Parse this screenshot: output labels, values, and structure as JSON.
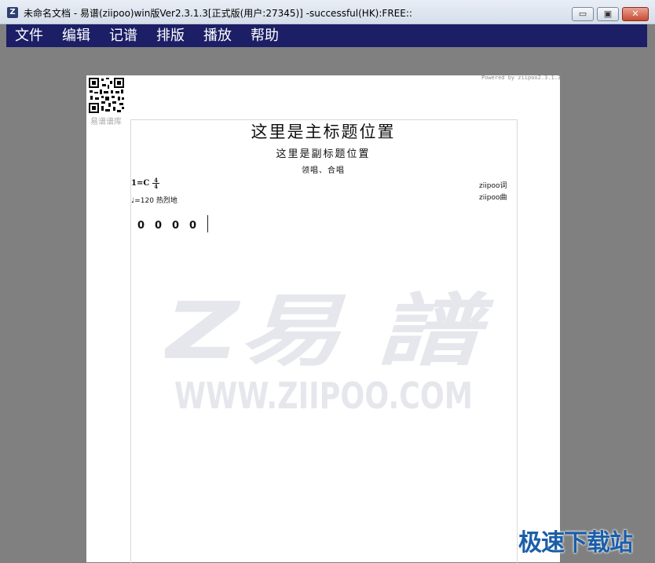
{
  "window": {
    "title": "未命名文档 - 易谱(ziipoo)win版Ver2.3.1.3[正式版(用户:27345)]  -successful(HK):FREE::",
    "icon": "ziipoo-app-icon",
    "controls": {
      "minimize": "▭",
      "maximize": "▣",
      "close": "✕"
    }
  },
  "menu": {
    "items": [
      {
        "label": "文件"
      },
      {
        "label": "编辑"
      },
      {
        "label": "记谱"
      },
      {
        "label": "排版"
      },
      {
        "label": "播放"
      },
      {
        "label": "帮助"
      }
    ]
  },
  "score": {
    "powered_by": "Powered by ziipoo2.3.1.3",
    "qr_label": "易谱谱库",
    "main_title": "这里是主标题位置",
    "sub_title": "这里是副标题位置",
    "singer": "领唱、合唱",
    "key": "1=C",
    "time_sig_top": "4",
    "time_sig_bottom": "4",
    "tempo": "=120 热烈地",
    "lyricist": "ziipoo词",
    "composer": "ziipoo曲",
    "notes": [
      "0",
      "0",
      "0",
      "0"
    ],
    "watermark_line1": "Z易 譜",
    "watermark_line2": "WWW.ZIIPOO.COM"
  },
  "corner_watermark": "极速下载站",
  "colors": {
    "menubar": "#1c1f66",
    "canvas": "#808080",
    "paper": "#ffffff",
    "watermark": "#e6e7ec",
    "corner_brand": "#1b5ea8"
  }
}
